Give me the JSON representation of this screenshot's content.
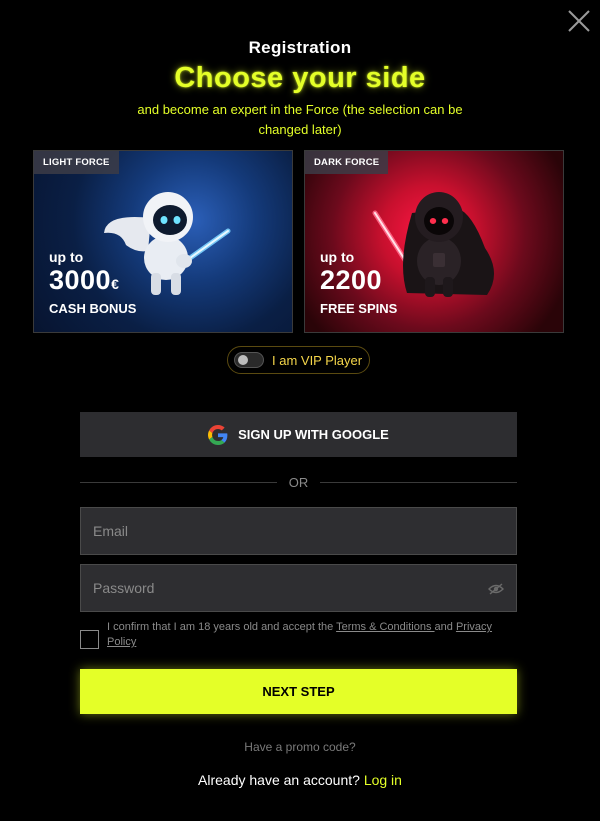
{
  "header": {
    "title": "Registration",
    "headline": "Choose your side",
    "subtitle": "and become an expert in the Force (the selection can be changed later)"
  },
  "cards": {
    "light": {
      "tag": "LIGHT FORCE",
      "upto": "up to",
      "amount": "3000",
      "currency": "€",
      "bonus": "CASH BONUS"
    },
    "dark": {
      "tag": "DARK FORCE",
      "upto": "up to",
      "amount": "2200",
      "bonus": "FREE SPINS"
    }
  },
  "vip": {
    "label": "I am VIP Player",
    "on": false
  },
  "google": {
    "label": "SIGN UP WITH GOOGLE"
  },
  "divider": {
    "label": "OR"
  },
  "form": {
    "email_placeholder": "Email",
    "email_value": "",
    "password_placeholder": "Password",
    "password_value": ""
  },
  "consent": {
    "text_before": "I confirm that I am 18 years old and accept the ",
    "terms_link": "Terms & Conditions ",
    "and": "and ",
    "privacy_link": "Privacy Policy",
    "checked": false
  },
  "next_button": {
    "label": "NEXT STEP"
  },
  "promo": {
    "label": "Have a promo code?"
  },
  "login": {
    "prompt": "Already have an account?",
    "link": "Log in"
  },
  "colors": {
    "accent": "#e4ff28",
    "vip_text": "#f5d64a",
    "background": "#000000"
  },
  "icons": {
    "close": "close-icon",
    "google": "google-icon",
    "eye": "eye-hidden-icon"
  }
}
